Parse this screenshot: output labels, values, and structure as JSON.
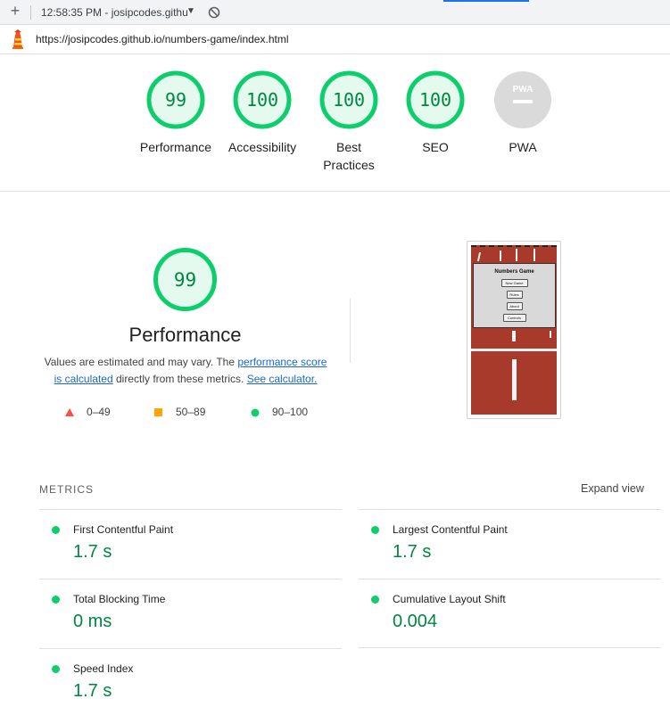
{
  "toolbar": {
    "new_tab_symbol": "+",
    "timestamp_title": "12:58:35 PM - josipcodes.githu",
    "dropdown_symbol": "▼"
  },
  "urlbar": {
    "icon": "lighthouse-icon",
    "url": "https://josipcodes.github.io/numbers-game/index.html"
  },
  "scores": [
    {
      "label": "Performance",
      "value": "99",
      "color": "#0cce6b"
    },
    {
      "label": "Accessibility",
      "value": "100",
      "color": "#0cce6b"
    },
    {
      "label": "Best Practices",
      "value": "100",
      "color": "#0cce6b"
    },
    {
      "label": "SEO",
      "value": "100",
      "color": "#0cce6b"
    },
    {
      "label": "PWA",
      "value": "",
      "badge_text": "PWA",
      "color": "#cccccc"
    }
  ],
  "performance": {
    "score": "99",
    "title": "Performance",
    "desc_prefix": "Values are estimated and may vary. The ",
    "link_score": "performance score is calculated",
    "desc_middle": " directly from these metrics. ",
    "link_calculator": "See calculator.",
    "legend": [
      {
        "range": "0–49",
        "shape": "triangle",
        "color": "#ff4e42"
      },
      {
        "range": "50–89",
        "shape": "square",
        "color": "#ffa400"
      },
      {
        "range": "90–100",
        "shape": "circle",
        "color": "#0cce6b"
      }
    ]
  },
  "screenshot": {
    "modal_title": "Numbers Game",
    "buttons": [
      "New Game",
      "Rules",
      "About",
      "Controls"
    ]
  },
  "metrics": {
    "header": "METRICS",
    "expand_label": "Expand view",
    "items": [
      {
        "name": "First Contentful Paint",
        "value": "1.7 s"
      },
      {
        "name": "Largest Contentful Paint",
        "value": "1.7 s"
      },
      {
        "name": "Total Blocking Time",
        "value": "0 ms"
      },
      {
        "name": "Cumulative Layout Shift",
        "value": "0.004"
      },
      {
        "name": "Speed Index",
        "value": "1.7 s"
      }
    ]
  },
  "colors": {
    "pass": "#0cce6b",
    "pass_text": "#018642",
    "pass_fill": "#e5faef",
    "link": "#1967d2"
  }
}
